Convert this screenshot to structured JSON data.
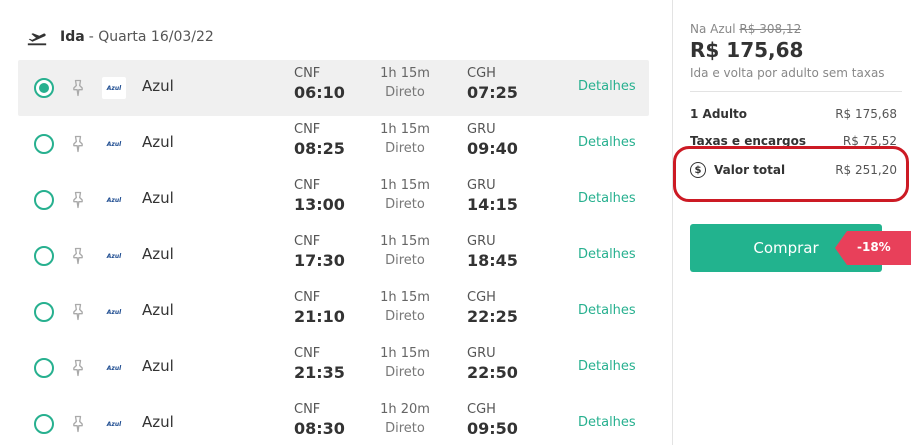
{
  "header": {
    "direction": "Ida",
    "date": "- Quarta 16/03/22"
  },
  "flights": [
    {
      "airline": "Azul",
      "logo": "Azul",
      "from": "CNF",
      "dep": "06:10",
      "duration": "1h 15m",
      "stops": "Direto",
      "to": "CGH",
      "arr": "07:25",
      "details": "Detalhes",
      "selected": true
    },
    {
      "airline": "Azul",
      "logo": "Azul",
      "from": "CNF",
      "dep": "08:25",
      "duration": "1h 15m",
      "stops": "Direto",
      "to": "GRU",
      "arr": "09:40",
      "details": "Detalhes",
      "selected": false
    },
    {
      "airline": "Azul",
      "logo": "Azul",
      "from": "CNF",
      "dep": "13:00",
      "duration": "1h 15m",
      "stops": "Direto",
      "to": "GRU",
      "arr": "14:15",
      "details": "Detalhes",
      "selected": false
    },
    {
      "airline": "Azul",
      "logo": "Azul",
      "from": "CNF",
      "dep": "17:30",
      "duration": "1h 15m",
      "stops": "Direto",
      "to": "GRU",
      "arr": "18:45",
      "details": "Detalhes",
      "selected": false
    },
    {
      "airline": "Azul",
      "logo": "Azul",
      "from": "CNF",
      "dep": "21:10",
      "duration": "1h 15m",
      "stops": "Direto",
      "to": "CGH",
      "arr": "22:25",
      "details": "Detalhes",
      "selected": false
    },
    {
      "airline": "Azul",
      "logo": "Azul",
      "from": "CNF",
      "dep": "21:35",
      "duration": "1h 15m",
      "stops": "Direto",
      "to": "GRU",
      "arr": "22:50",
      "details": "Detalhes",
      "selected": false
    },
    {
      "airline": "Azul",
      "logo": "Azul",
      "from": "CNF",
      "dep": "08:30",
      "duration": "1h 20m",
      "stops": "Direto",
      "to": "CGH",
      "arr": "09:50",
      "details": "Detalhes",
      "selected": false
    }
  ],
  "summary": {
    "na_label": "Na Azul",
    "old_price": "R$ 308,12",
    "price": "R$ 175,68",
    "sub": "Ida e volta por adulto sem taxas",
    "adult_label": "1 Adulto",
    "adult_value": "R$ 175,68",
    "taxes_label": "Taxas e encargos",
    "taxes_value": "R$ 75,52",
    "total_icon": "$",
    "total_label": "Valor total",
    "total_value": "R$ 251,20",
    "buy_label": "Comprar",
    "discount": "-18%"
  },
  "colors": {
    "accent": "#22b38e",
    "highlight": "#cc1a24",
    "badge": "#e8405a"
  }
}
